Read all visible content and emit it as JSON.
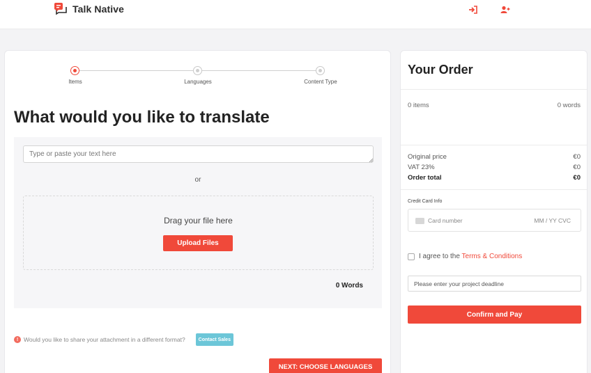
{
  "header": {
    "brand": "Talk Native",
    "login_icon": "sign-in-icon",
    "register_icon": "user-plus-icon"
  },
  "stepper": {
    "steps": [
      {
        "label": "Items",
        "active": true
      },
      {
        "label": "Languages",
        "active": false
      },
      {
        "label": "Content Type",
        "active": false
      }
    ]
  },
  "main": {
    "title": "What would you like to translate",
    "text_placeholder": "Type or paste your text here",
    "text_value": "",
    "or_label": "or",
    "drop_label": "Drag your file here",
    "upload_button": "Upload Files",
    "word_count": "0 Words",
    "attachment_question": "Would you like to share your attachment in a different format?",
    "contact_button": "Contact Sales",
    "next_button": "NEXT: CHOOSE LANGUAGES"
  },
  "order": {
    "title": "Your Order",
    "items": "0 items",
    "words": "0 words",
    "original_price_label": "Original price",
    "original_price": "€0",
    "vat_label": "VAT 23%",
    "vat": "€0",
    "total_label": "Order total",
    "total": "€0",
    "credit_card_label": "Credit Card Info",
    "card_number_placeholder": "Card number",
    "card_exp_cvc_placeholder": "MM / YY  CVC",
    "agree_prefix": "I agree to the ",
    "terms_link": "Terms & Conditions",
    "deadline_placeholder": "Please enter your project deadline",
    "pay_button": "Confirm and Pay"
  },
  "colors": {
    "accent": "#f0493a",
    "contact": "#6cc6d8"
  }
}
